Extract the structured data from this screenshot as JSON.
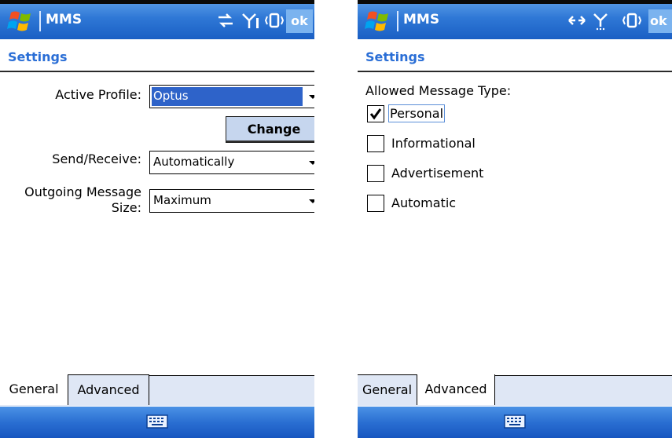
{
  "colors": {
    "title_bar": "#2f78d6",
    "header_text": "#2a6ed6",
    "selection": "#2e63c9",
    "tab_strip": "#dfe7f5",
    "button_face": "#c6d6ee"
  },
  "left": {
    "title_bar": {
      "app_title": "MMS",
      "icons": [
        "windows-flag-icon",
        "connectivity-icon",
        "signal-icon",
        "vibrate-icon"
      ],
      "ok_label": "ok"
    },
    "header": {
      "title": "Settings"
    },
    "form": {
      "active_profile_label": "Active Profile:",
      "active_profile_value": "Optus",
      "change_label": "Change",
      "send_receive_label": "Send/Receive:",
      "send_receive_value": "Automatically",
      "outgoing_size_label_line1": "Outgoing Message",
      "outgoing_size_label_line2": "Size:",
      "outgoing_size_value": "Maximum"
    },
    "tabs": [
      {
        "label": "General",
        "active": true
      },
      {
        "label": "Advanced",
        "active": false
      }
    ],
    "bottom_bar": {
      "icon": "keyboard-icon"
    }
  },
  "right": {
    "title_bar": {
      "app_title": "MMS",
      "icons": [
        "windows-flag-icon",
        "sync-icon",
        "signal-icon",
        "vibrate-icon"
      ],
      "ok_label": "ok"
    },
    "header": {
      "title": "Settings"
    },
    "section_label": "Allowed Message Type:",
    "checkboxes": [
      {
        "label": "Personal",
        "checked": true
      },
      {
        "label": "Informational",
        "checked": false
      },
      {
        "label": "Advertisement",
        "checked": false
      },
      {
        "label": "Automatic",
        "checked": false
      }
    ],
    "tabs": [
      {
        "label": "General",
        "active": false
      },
      {
        "label": "Advanced",
        "active": true
      }
    ],
    "bottom_bar": {
      "icon": "keyboard-icon"
    }
  }
}
